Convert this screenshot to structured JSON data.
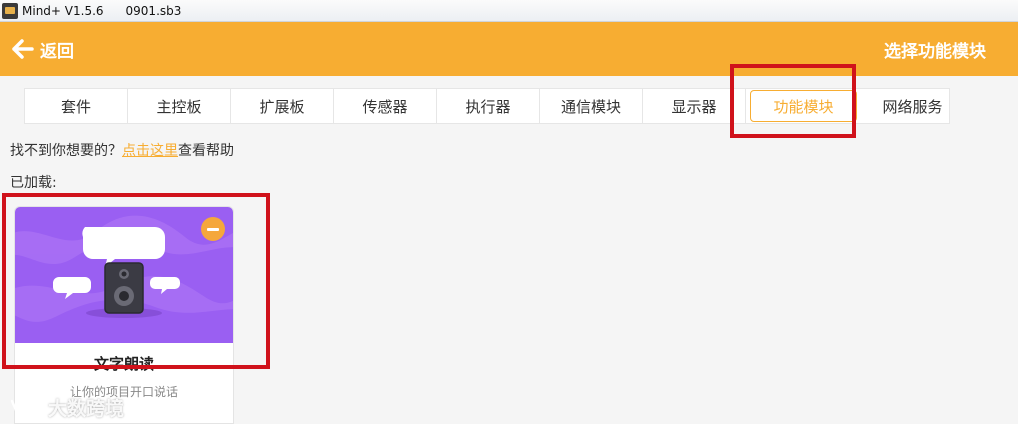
{
  "window": {
    "app_title": "Mind+ V1.5.6",
    "file_name": "0901.sb3"
  },
  "header": {
    "back_label": "返回",
    "title": "选择功能模块",
    "background": "#f7ad32"
  },
  "tabs": [
    {
      "label": "套件",
      "active": false
    },
    {
      "label": "主控板",
      "active": false
    },
    {
      "label": "扩展板",
      "active": false
    },
    {
      "label": "传感器",
      "active": false
    },
    {
      "label": "执行器",
      "active": false
    },
    {
      "label": "通信模块",
      "active": false
    },
    {
      "label": "显示器",
      "active": false
    },
    {
      "label": "功能模块",
      "active": true
    },
    {
      "label": "网络服务",
      "active": false
    }
  ],
  "help": {
    "prefix": "找不到你想要的？",
    "link": "点击这里",
    "suffix": "查看帮助"
  },
  "loaded": {
    "label": "已加载:",
    "items": [
      {
        "title": "文字朗读",
        "description": "让你的项目开口说话",
        "icon": "speaker-with-speech-bubbles",
        "image_background": "#9a5ff2"
      }
    ]
  },
  "watermark": {
    "text": "大数跨境"
  },
  "colors": {
    "accent": "#f7ad32",
    "highlight": "#d0121b",
    "remove_button": "#f5a73b"
  }
}
